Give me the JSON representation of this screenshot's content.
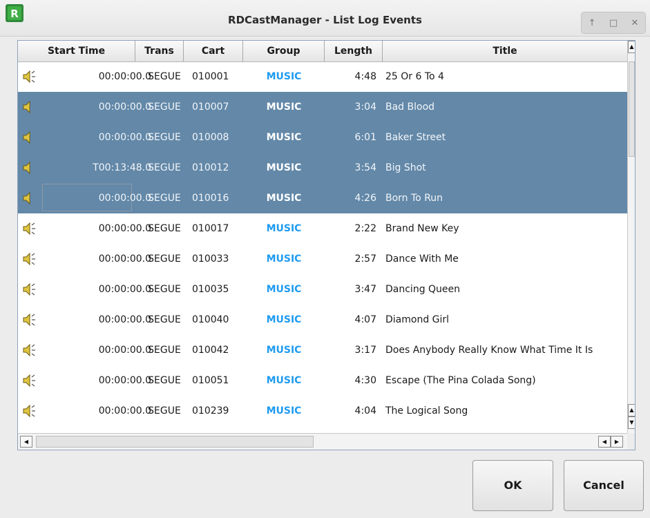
{
  "window": {
    "title": "RDCastManager - List Log Events",
    "controls": [
      "↑",
      "□",
      "✕"
    ]
  },
  "columns": {
    "start_time": "Start Time",
    "trans": "Trans",
    "cart": "Cart",
    "group": "Group",
    "length": "Length",
    "title": "Title"
  },
  "rows": [
    {
      "start": "00:00:00.0",
      "trans": "SEGUE",
      "cart": "010001",
      "group": "MUSIC",
      "length": "4:48",
      "title": "25 Or 6 To 4",
      "selected": false
    },
    {
      "start": "00:00:00.0",
      "trans": "SEGUE",
      "cart": "010007",
      "group": "MUSIC",
      "length": "3:04",
      "title": "Bad Blood",
      "selected": true
    },
    {
      "start": "00:00:00.0",
      "trans": "SEGUE",
      "cart": "010008",
      "group": "MUSIC",
      "length": "6:01",
      "title": "Baker Street",
      "selected": true
    },
    {
      "start": "T00:13:48.0",
      "trans": "SEGUE",
      "cart": "010012",
      "group": "MUSIC",
      "length": "3:54",
      "title": "Big Shot",
      "selected": true
    },
    {
      "start": "00:00:00.0",
      "trans": "SEGUE",
      "cart": "010016",
      "group": "MUSIC",
      "length": "4:26",
      "title": "Born To Run",
      "selected": true
    },
    {
      "start": "00:00:00.0",
      "trans": "SEGUE",
      "cart": "010017",
      "group": "MUSIC",
      "length": "2:22",
      "title": "Brand New Key",
      "selected": false
    },
    {
      "start": "00:00:00.0",
      "trans": "SEGUE",
      "cart": "010033",
      "group": "MUSIC",
      "length": "2:57",
      "title": "Dance With Me",
      "selected": false
    },
    {
      "start": "00:00:00.0",
      "trans": "SEGUE",
      "cart": "010035",
      "group": "MUSIC",
      "length": "3:47",
      "title": "Dancing Queen",
      "selected": false
    },
    {
      "start": "00:00:00.0",
      "trans": "SEGUE",
      "cart": "010040",
      "group": "MUSIC",
      "length": "4:07",
      "title": "Diamond Girl",
      "selected": false
    },
    {
      "start": "00:00:00.0",
      "trans": "SEGUE",
      "cart": "010042",
      "group": "MUSIC",
      "length": "3:17",
      "title": "Does Anybody Really Know What Time It Is",
      "selected": false
    },
    {
      "start": "00:00:00.0",
      "trans": "SEGUE",
      "cart": "010051",
      "group": "MUSIC",
      "length": "4:30",
      "title": "Escape (The Pina Colada Song)",
      "selected": false
    },
    {
      "start": "00:00:00.0",
      "trans": "SEGUE",
      "cart": "010239",
      "group": "MUSIC",
      "length": "4:04",
      "title": "The Logical Song",
      "selected": false
    }
  ],
  "icons": {
    "row_icon": "speaker-icon",
    "app_icon": "rd-app-icon"
  },
  "colors": {
    "selection": "#6388a8",
    "group_music": "#1e9bf0",
    "panel_border": "#8da3bd"
  },
  "buttons": {
    "ok": "OK",
    "cancel": "Cancel"
  }
}
